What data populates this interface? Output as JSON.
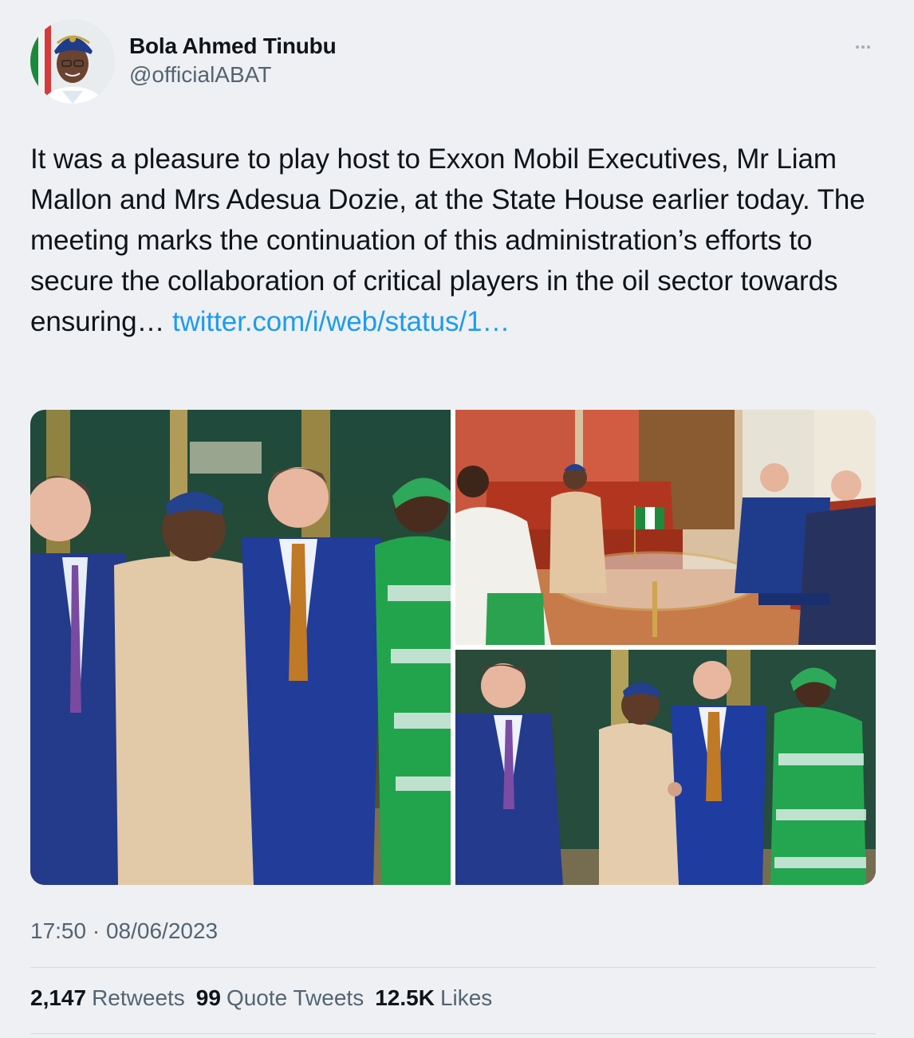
{
  "author": {
    "name": "Bola Ahmed Tinubu",
    "handle": "@officialABAT"
  },
  "tweet": {
    "text": "It was a pleasure to play host to Exxon Mobil Executives, Mr Liam Mallon and Mrs Adesua Dozie, at the State House earlier today. The meeting marks the continuation of this administration’s efforts to secure the collaboration of critical players in the oil sector towards ensuring… ",
    "link": "twitter.com/i/web/status/1…",
    "time": "17:50",
    "separator": "·",
    "date": "08/06/2023"
  },
  "stats": {
    "retweets": {
      "count": "2,147",
      "label": "Retweets"
    },
    "quotes": {
      "count": "99",
      "label": "Quote Tweets"
    },
    "likes": {
      "count": "12.5K",
      "label": "Likes"
    }
  },
  "colors": {
    "background": "#eef0f3",
    "link": "#1d9bf0",
    "secondary_text": "#536471"
  }
}
